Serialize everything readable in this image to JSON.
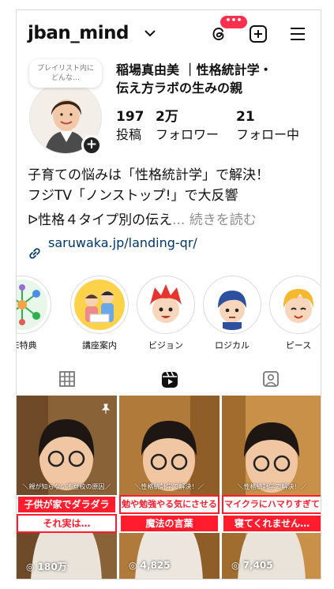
{
  "header": {
    "username": "jban_mind",
    "notification_badge": "•••"
  },
  "profile": {
    "note": "プレイリスト内にどんな…",
    "name_line1": "稲場真由美 ｜性格統計学・",
    "name_line2": "伝え方ラボの生みの親",
    "stats": [
      {
        "value": "197",
        "label": "投稿"
      },
      {
        "value": "2万",
        "label": "フォロワー"
      },
      {
        "value": "21",
        "label": "フォロー中"
      }
    ],
    "bio_line1": "子育ての悩みは「性格統計学」で解決！",
    "bio_line2": "フジTV「ノンストップ!」で大反響",
    "bio_line3": "ᐅ性格４タイプ別の伝え",
    "bio_more": "... 続きを読む",
    "link": "saruwaka.jp/landing-qr/"
  },
  "highlights": [
    {
      "label": "NE特典",
      "icon": "network-people-icon"
    },
    {
      "label": "講座案内",
      "icon": "family-illustration-icon"
    },
    {
      "label": "ビジョン",
      "icon": "red-hair-character-icon"
    },
    {
      "label": "ロジカル",
      "icon": "blue-hair-character-icon"
    },
    {
      "label": "ピース",
      "icon": "yellow-hair-character-icon"
    }
  ],
  "tabs": [
    {
      "name": "grid",
      "icon": "grid-icon"
    },
    {
      "name": "reels",
      "icon": "reels-icon",
      "active": true
    },
    {
      "name": "tagged",
      "icon": "tagged-person-icon"
    }
  ],
  "posts": [
    {
      "caption": "＼親が知らない不登校の原因／",
      "banner1": "子供が家でダラダラ",
      "banner2": "それ実は…",
      "views": "180万",
      "pinned": true
    },
    {
      "caption": "＼性格統計学で解決！／",
      "banner1": "勉や勉強やる気にさせる",
      "banner2": "魔法の言葉",
      "views": "4,825",
      "pinned": false
    },
    {
      "caption": "＼性格統計学で解決！／",
      "banner1": "マイクラにハマりすぎて",
      "banner2": "寝てくれません…",
      "views": "7,405",
      "pinned": false
    }
  ],
  "colors": {
    "badge": "#ff2f4f",
    "link": "#00376b",
    "banner_red": "#ff1d2d"
  }
}
